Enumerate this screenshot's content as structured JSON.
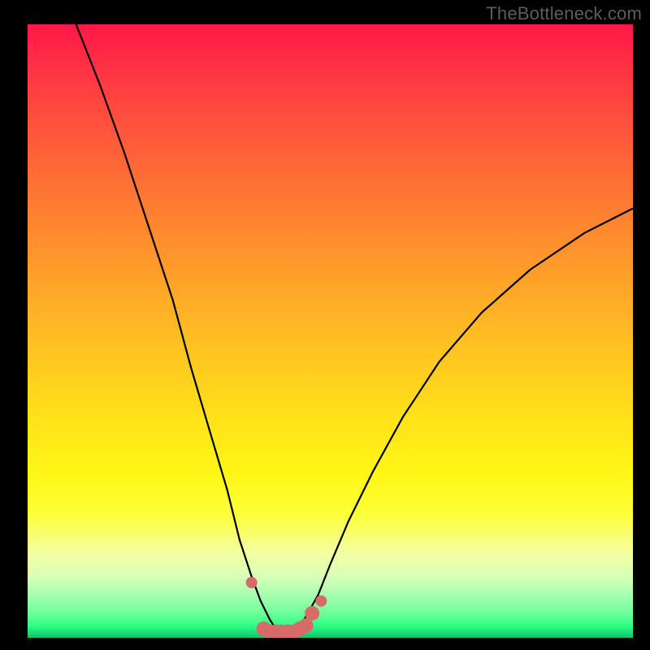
{
  "watermark": "TheBottleneck.com",
  "colors": {
    "background": "#000000",
    "curve": "#000000",
    "marker": "#d96a6a",
    "gradient_top": "#ff1846",
    "gradient_bottom": "#0cc569"
  },
  "chart_data": {
    "type": "line",
    "title": "",
    "xlabel": "",
    "ylabel": "",
    "xlim": [
      0,
      100
    ],
    "ylim": [
      0,
      100
    ],
    "x": [
      8,
      12,
      16,
      20,
      24,
      27,
      30,
      33,
      35,
      37,
      38.5,
      40,
      41,
      42,
      43,
      44,
      45,
      46,
      48,
      50,
      53,
      57,
      62,
      68,
      75,
      83,
      92,
      100
    ],
    "y": [
      100,
      90,
      79,
      67,
      55,
      44,
      34,
      24,
      16,
      10,
      6,
      3,
      1.5,
      1,
      1,
      1.2,
      2,
      3.5,
      7,
      12,
      19,
      27,
      36,
      45,
      53,
      60,
      66,
      70
    ],
    "markers": {
      "x": [
        37,
        39,
        40,
        41,
        42,
        43,
        44,
        45,
        46,
        47,
        48.5
      ],
      "y": [
        9,
        1.5,
        1,
        1,
        1,
        1,
        1,
        1.5,
        2,
        4,
        6
      ]
    },
    "annotations": []
  }
}
